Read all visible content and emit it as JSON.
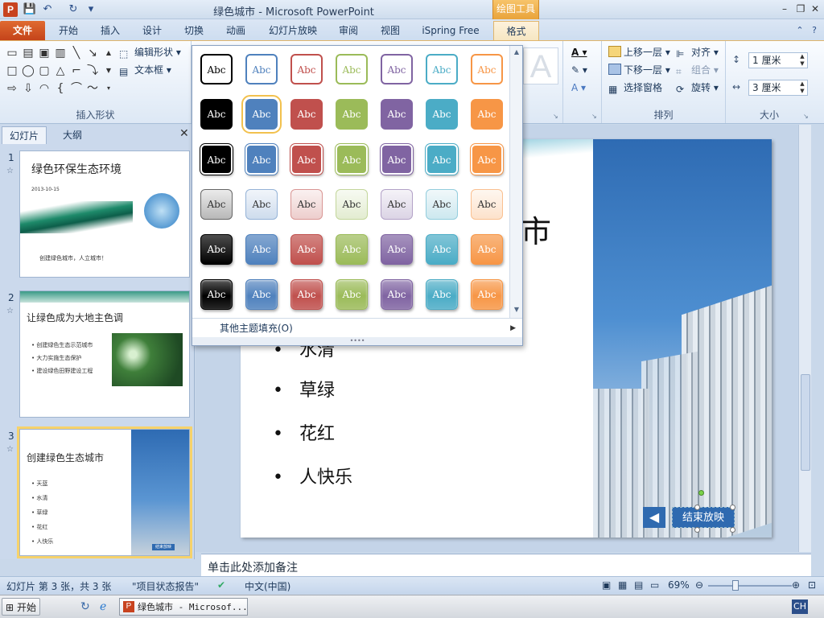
{
  "window": {
    "app_icon": "P",
    "title": "绿色城市 - Microsoft PowerPoint",
    "contextual_tool": "绘图工具",
    "minimize": "–",
    "restore": "❐",
    "close": "✕"
  },
  "qat": {
    "save": "💾",
    "undo": "↶",
    "redo": "↻",
    "customize": "▾"
  },
  "tabs": {
    "file": "文件",
    "home": "开始",
    "insert": "插入",
    "design": "设计",
    "transitions": "切换",
    "animations": "动画",
    "slideshow": "幻灯片放映",
    "review": "审阅",
    "view": "视图",
    "ispring": "iSpring Free",
    "format": "格式",
    "help": "?"
  },
  "ribbon": {
    "insert_shapes_label": "插入形状",
    "edit_shape": "编辑形状",
    "text_box": "文本框",
    "arrange_label": "排列",
    "bring_forward": "上移一层",
    "send_backward": "下移一层",
    "selection_pane": "选择窗格",
    "align": "对齐",
    "group": "组合",
    "rotate": "旋转",
    "size_label": "大小",
    "height_value": "1 厘米",
    "width_value": "3 厘米",
    "wordart_letter": "A"
  },
  "left_panel": {
    "tab_slides": "幻灯片",
    "tab_outline": "大纲",
    "close": "✕",
    "slides": [
      {
        "number": "1",
        "title": "绿色环保生态环境",
        "date": "2013-10-15",
        "caption": "创建绿色城市，人立城市！"
      },
      {
        "number": "2",
        "title": "让绿色成为大地主色调",
        "bullets": [
          "创建绿色生态示范城市",
          "大力实施生态保护",
          "建设绿色田野建设工程"
        ]
      },
      {
        "number": "3",
        "title": "创建绿色生态城市",
        "bullets": [
          "天蓝",
          "水清",
          "草绿",
          "花红",
          "人快乐"
        ],
        "button": "结束放映"
      }
    ]
  },
  "slide": {
    "title_fragment": "城市",
    "bullets": [
      "水清",
      "草绿",
      "花红",
      "人快乐"
    ],
    "end_show_button": "结束放映",
    "back_arrow": "◀"
  },
  "gallery": {
    "cell_text": "Abc",
    "more_fills": "其他主题填充(O)",
    "more_fills_arrow": "▶",
    "colors": [
      "#000000",
      "#4f81bd",
      "#c0504d",
      "#9bbb59",
      "#8064a2",
      "#4bacc6",
      "#f79646"
    ]
  },
  "notes": {
    "placeholder": "单击此处添加备注"
  },
  "status": {
    "slide_info": "幻灯片 第 3 张，共 3 张",
    "theme": "\"项目状态报告\"",
    "language": "中文(中国)",
    "zoom": "69%"
  },
  "taskbar": {
    "start": "开始",
    "ppt_window": "绿色城市 - Microsof...",
    "lang": "CH"
  }
}
